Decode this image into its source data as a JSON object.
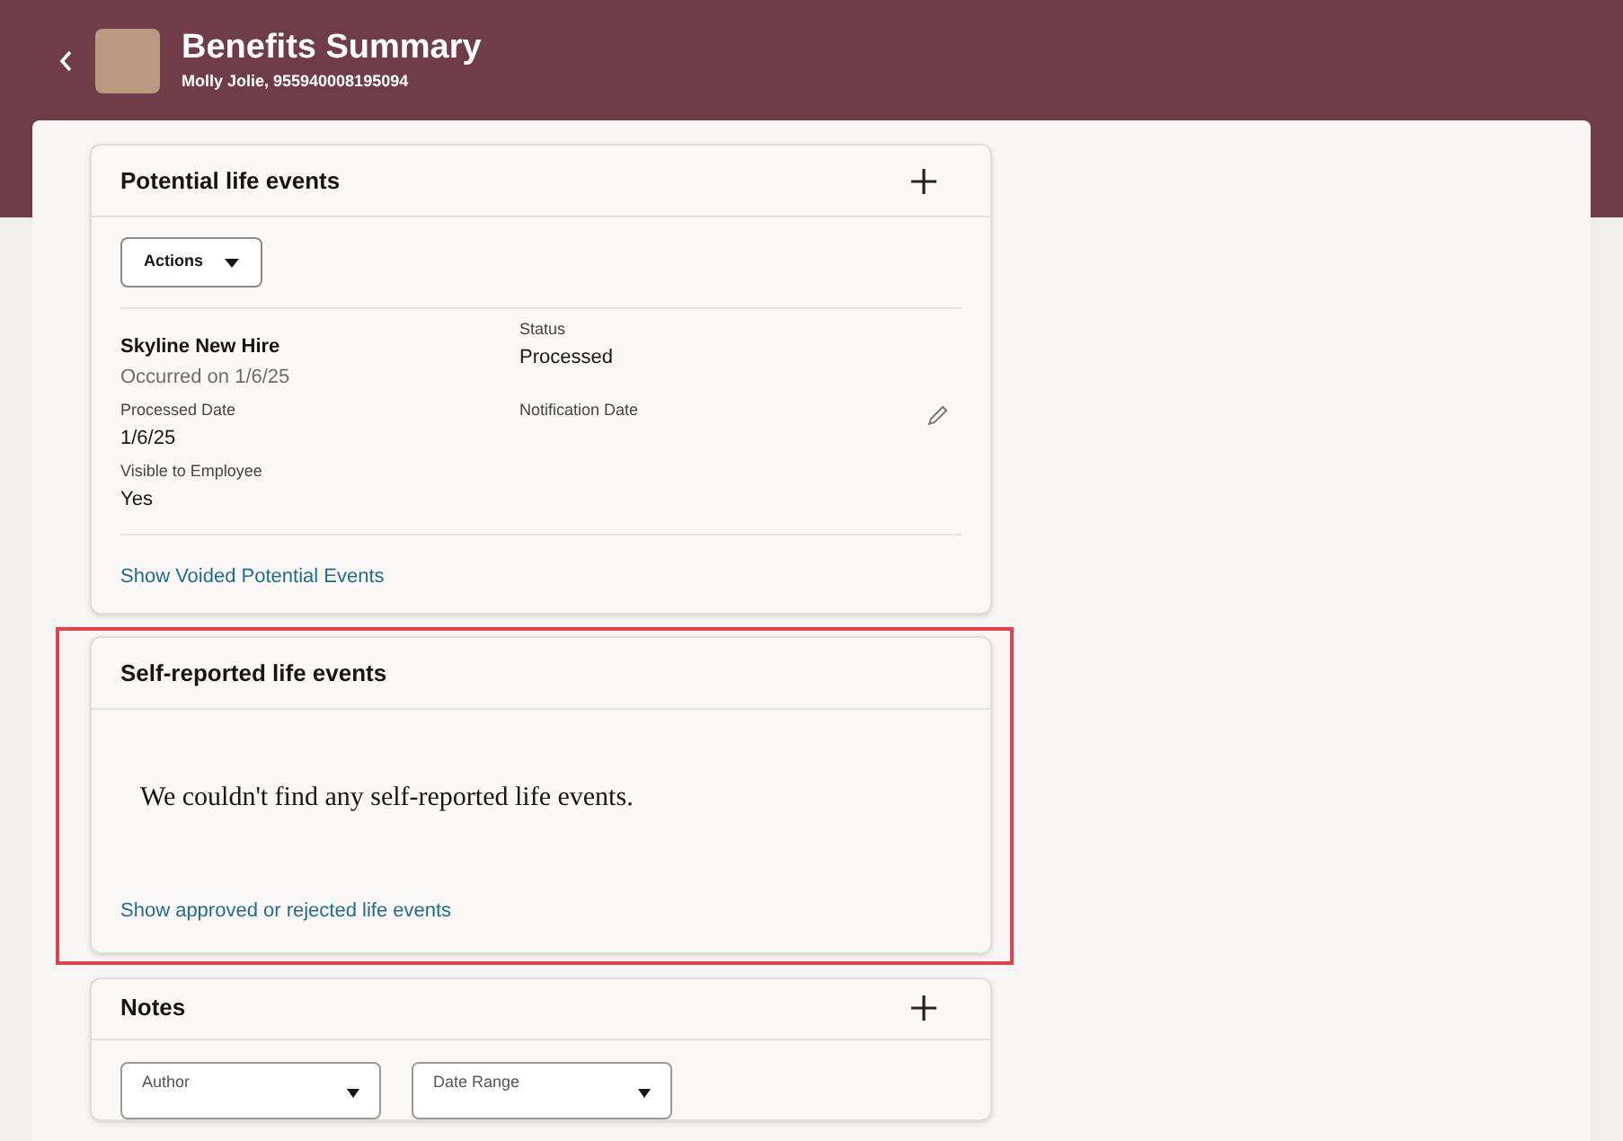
{
  "header": {
    "title": "Benefits Summary",
    "subtitle": "Molly Jolie, 955940008195094"
  },
  "potential_life_events": {
    "title": "Potential life events",
    "actions_button": "Actions",
    "event": {
      "name": "Skyline New Hire",
      "occurred": "Occurred on 1/6/25",
      "fields": [
        {
          "label": "Status",
          "value": "Processed"
        },
        {
          "label": "Processed Date",
          "value": "1/6/25"
        },
        {
          "label": "Notification Date"
        },
        {
          "label": "Visible to Employee",
          "value": "Yes"
        }
      ]
    },
    "link": "Show Voided Potential Events"
  },
  "self_reported_life_events": {
    "title": "Self-reported life events",
    "highlighted": true,
    "message": "We couldn't find any self-reported life events.",
    "link": "Show approved or rejected life events"
  },
  "notes": {
    "title": "Notes",
    "filters": [
      {
        "label": "Author"
      },
      {
        "label": "Date Range"
      }
    ]
  }
}
